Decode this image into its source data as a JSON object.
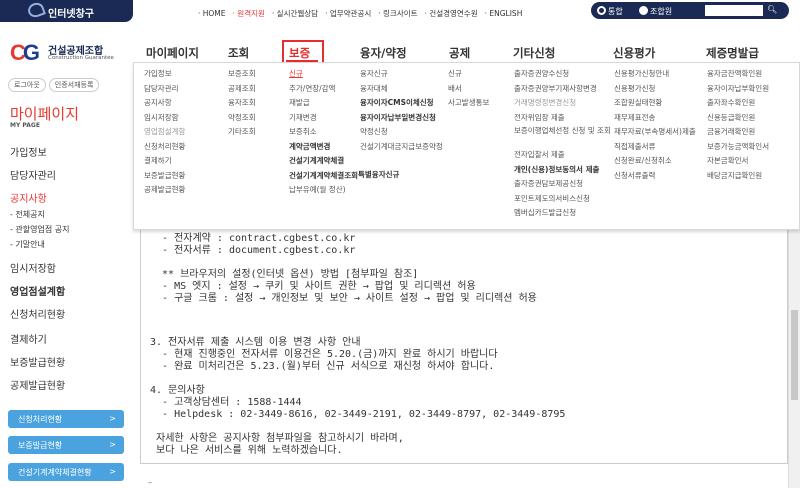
{
  "topbar": {
    "logo_text": "인터넷창구",
    "util_links": [
      "· HOME",
      "· 원격지원",
      "· 실시간웹상담",
      "· 업무약관공시",
      "· 링크사이트",
      "· 건설경영연수원",
      "· ENGLISH"
    ],
    "search_options": [
      "통합",
      "조합원"
    ],
    "search_value": ""
  },
  "header": {
    "logo_mark": "CG",
    "logo_title": "건설공제조합",
    "logo_subtitle": "Construction Guarantee"
  },
  "gnb": {
    "items": [
      "마이페이지",
      "조회",
      "보증",
      "융자/약정",
      "공제",
      "기타신청",
      "신용평가",
      "제증명발급"
    ]
  },
  "mega": {
    "columns": [
      [
        "가입정보",
        "담당자관리",
        "공지사항",
        "임시저장함",
        "영업점설계함",
        "신청처리현황",
        "결제하기",
        "보증발급현황",
        "공제발급현황"
      ],
      [
        "보증조회",
        "공제조회",
        "융자조회",
        "약정조회",
        "기타조회"
      ],
      [
        "신규",
        "추가/연장/감액",
        "재발급",
        "기재변경",
        "보증취소",
        "계약금액변경",
        "건설기계계약체결",
        "건설기계계약체결조회",
        "납부유예(월 정산)"
      ],
      [
        "융자신규",
        "융자대체",
        "융자이자CMS이체신청",
        "융자이자납부일변경신청",
        "약정신청",
        "건설기계대금지급보증약정",
        "특별융자신규"
      ],
      [
        "신규",
        "배서",
        "사고발생통보"
      ],
      [
        "출자증권양수신청",
        "출자증권양부기재사항변경",
        "거래명령정변경신청",
        "전자위임장 제출",
        "보증이행업체선정 신청 및 조회",
        "전자입찰서 제출",
        "개인(신용)정보동의서 제출",
        "출자증권담보제공신청",
        "포인트제도의서비스신청",
        "멤버십카드발급신청"
      ],
      [
        "신용평가신청안내",
        "신용평가신청",
        "조합원실태현황",
        "재무제표전송",
        "재무자료(부속명세서)제출",
        "직접제출서류",
        "신청완료/신청취소",
        "신청서류출력"
      ],
      [
        "융자금잔액확인원",
        "융자이자납부확인원",
        "출자좌수확인원",
        "신용등급확인원",
        "금융거래확인원",
        "보증가능금액확인서",
        "자본금확인서",
        "배당금지급확인원"
      ]
    ]
  },
  "sidebar": {
    "login_buttons": [
      "로그아웃",
      "인증서재등록"
    ],
    "title": "마이페이지",
    "subtitle": "MY PAGE",
    "menu": [
      {
        "label": "가입정보"
      },
      {
        "label": "담당자관리"
      },
      {
        "label": "공지사항"
      },
      {
        "label": "- 전체공지"
      },
      {
        "label": "- 관할영업점 공지"
      },
      {
        "label": "- 기말안내"
      },
      {
        "label": "임시저장함"
      },
      {
        "label": "영업점설계함"
      },
      {
        "label": "신청처리현황"
      },
      {
        "label": "결제하기"
      },
      {
        "label": "보증발급현황"
      },
      {
        "label": "공제발급현황"
      }
    ],
    "quick_buttons": [
      "신청처리현황",
      "보증발급현황",
      "건설기계계약체결현황"
    ]
  },
  "content": {
    "lines": [
      "  - 전자계약 : contract.cgbest.co.kr",
      "  - 전자서류 : document.cgbest.co.kr",
      "",
      "  ** 브라우저의 설정(인터넷 옵션) 방법 [첨부파일 참조]",
      "  - MS 엣지 : 설정 → 쿠키 및 사이트 권한 → 팝업 및 리디렉션 허용",
      "  - 구글 크롬 : 설정 → 개인정보 및 보안 → 사이트 설정 → 팝업 및 리디렉션 허용",
      "",
      "",
      "3. 전자서류 제출 시스템 이용 변경 사항 안내",
      "  - 현재 진행중인 전자서류 이용건은 5.20.(금)까지 완료 하시기 바랍니다",
      "  - 완료 미처리건은 5.23.(월)부터 신규 서식으로 재신청 하셔야 합니다.",
      "",
      "4. 문의사항",
      "  - 고객상담센터 : 1588-1444",
      "  - Helpdesk : 02-3449-8616, 02-3449-2191, 02-3449-8797, 02-3449-8795",
      "",
      " 자세한 사항은 공지사항 첨부파일을 참고하시기 바라며,",
      " 보다 나은 서비스를 위해 노력하겠습니다."
    ]
  }
}
